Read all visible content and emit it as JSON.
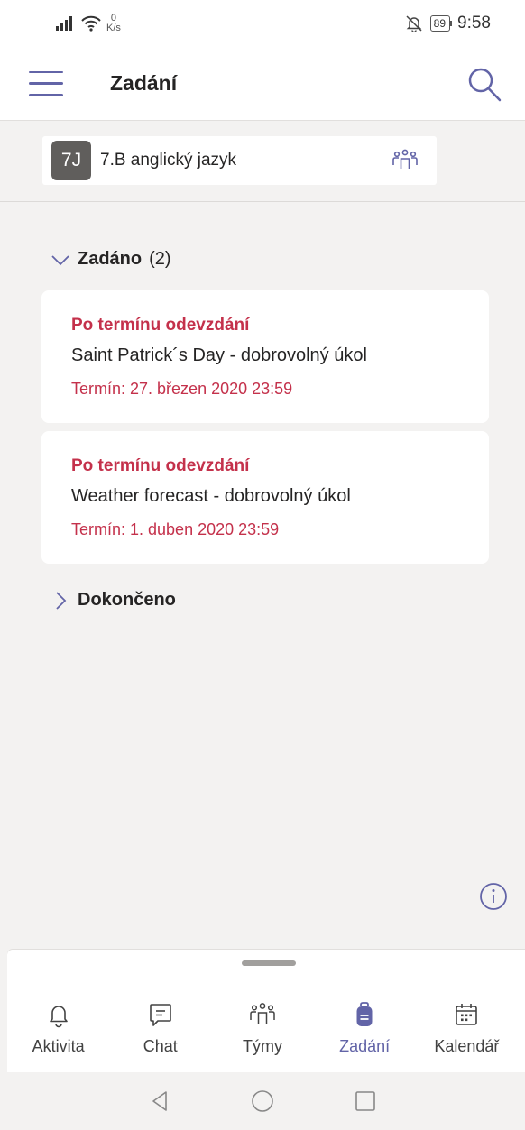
{
  "status_bar": {
    "speed_value": "0",
    "speed_unit": "K/s",
    "battery": "89",
    "time": "9:58",
    "icons": [
      "signal-icon",
      "wifi-icon",
      "bell-off-icon",
      "battery-icon"
    ]
  },
  "header": {
    "title": "Zadání",
    "menu_icon": "hamburger-menu-icon",
    "search_icon": "search-icon"
  },
  "class_bar": {
    "avatar_text": "7J",
    "name": "7.B anglický jazyk",
    "icon": "team-icon"
  },
  "sections": {
    "assigned": {
      "label": "Zadáno",
      "count": "(2)",
      "expanded": true
    },
    "completed": {
      "label": "Dokončeno",
      "expanded": false
    }
  },
  "assignments": [
    {
      "status": "Po termínu odevzdání",
      "name": "Saint Patrick´s Day - dobrovolný úkol",
      "due": "Termín: 27. březen 2020 23:59"
    },
    {
      "status": "Po termínu odevzdání",
      "name": "Weather forecast - dobrovolný úkol",
      "due": "Termín: 1. duben 2020 23:59"
    }
  ],
  "bottom_nav": {
    "items": [
      {
        "label": "Aktivita",
        "icon": "bell-icon",
        "active": false
      },
      {
        "label": "Chat",
        "icon": "chat-icon",
        "active": false
      },
      {
        "label": "Týmy",
        "icon": "teams-icon",
        "active": false
      },
      {
        "label": "Zadání",
        "icon": "backpack-icon",
        "active": true
      },
      {
        "label": "Kalendář",
        "icon": "calendar-icon",
        "active": false
      }
    ]
  },
  "colors": {
    "accent": "#6264a7",
    "overdue": "#c4314b",
    "background": "#f3f2f1"
  }
}
